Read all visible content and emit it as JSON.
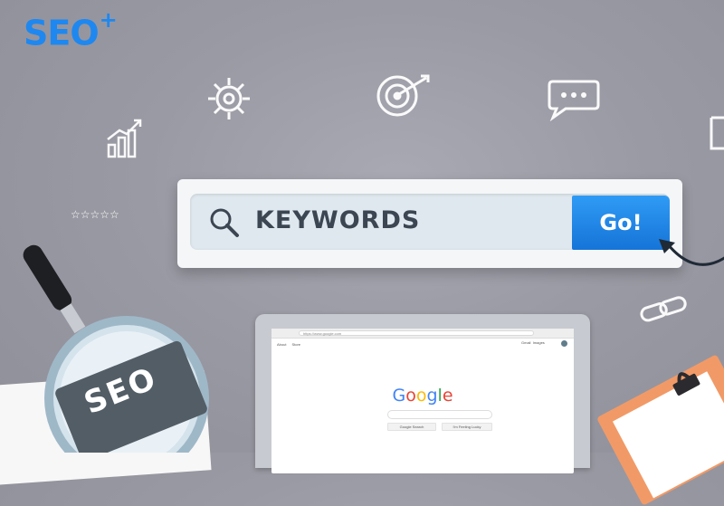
{
  "logo": {
    "text": "SEO",
    "plus": "+"
  },
  "search": {
    "query": "KEYWORDS",
    "button_label": "Go!"
  },
  "magnifier": {
    "label": "SEO"
  },
  "rating": {
    "stars": 5
  },
  "browser": {
    "url": "https://www.google.com",
    "links": [
      "About",
      "Store"
    ],
    "right_links": [
      "Gmail",
      "Images"
    ],
    "logo": [
      "G",
      "o",
      "o",
      "g",
      "l",
      "e"
    ],
    "buttons": [
      "Google Search",
      "I'm Feeling Lucky"
    ]
  },
  "colors": {
    "accent": "#1e88f0",
    "button": "#1a7ee0",
    "background": "#9a9aa4",
    "google": [
      "#4285f4",
      "#ea4335",
      "#fbbc05",
      "#4285f4",
      "#34a853",
      "#ea4335"
    ]
  },
  "icons": [
    "gear-icon",
    "target-icon",
    "speech-bubble-icon",
    "bar-chart-icon",
    "link-icon",
    "search-icon",
    "cursor-arrow-icon"
  ]
}
